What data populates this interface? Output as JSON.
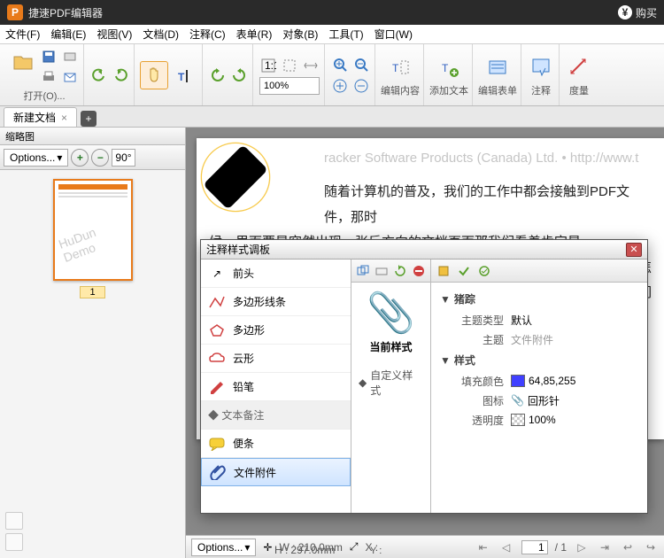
{
  "titlebar": {
    "app_name": "捷速PDF编辑器",
    "buy": "购买"
  },
  "menu": {
    "file": "文件(F)",
    "edit": "编辑(E)",
    "view": "视图(V)",
    "document": "文档(D)",
    "comment": "注释(C)",
    "form": "表单(R)",
    "object": "对象(B)",
    "tool": "工具(T)",
    "window": "窗口(W)"
  },
  "ribbon": {
    "open": "打开(O)...",
    "zoom_value": "100%",
    "edit_content": "编辑内容",
    "add_text": "添加文本",
    "edit_form": "编辑表单",
    "annotate": "注释",
    "measure": "度量"
  },
  "doctab": {
    "name": "新建文档",
    "close": "×"
  },
  "thumbs": {
    "header": "缩略图",
    "options": "Options...",
    "rotate": "90°",
    "page_num": "1",
    "watermark": "HuDun Demo"
  },
  "page": {
    "watermark": "racker Software Products (Canada) Ltd. • http://www.t",
    "line1": "随着计算机的普及，我们的工作中都会接触到PDF文件，那时",
    "line2": "候，里面要是突然出现一张反方向的文档页面那我们看着肯定是",
    "line3": "大家怎",
    "line4": "装在我们"
  },
  "status": {
    "options": "Options...",
    "w": "W :",
    "w_val": "210.0mm",
    "h": "H :",
    "h_val": "297.0mm",
    "x": "X :",
    "y": "Y :",
    "page": "1",
    "total": "/ 1"
  },
  "dialog": {
    "title": "注释样式调板",
    "shapes": {
      "arrow": "前头",
      "polyline": "多边形线条",
      "polygon": "多边形",
      "cloud": "云形",
      "pencil": "铅笔",
      "section_text": "◆ 文本备注",
      "sticky": "便条",
      "attachment": "文件附件"
    },
    "preview": {
      "current": "当前样式",
      "custom": "自定义样式"
    },
    "props": {
      "sec1": "猪踪",
      "subject_type": "主题类型",
      "subject_type_v": "默认",
      "subject": "主题",
      "subject_v": "文件附件",
      "sec2": "样式",
      "fill": "填充颜色",
      "fill_v": "64,85,255",
      "icon": "图标",
      "icon_v": "回形针",
      "opacity": "透明度",
      "opacity_v": "100%"
    }
  }
}
